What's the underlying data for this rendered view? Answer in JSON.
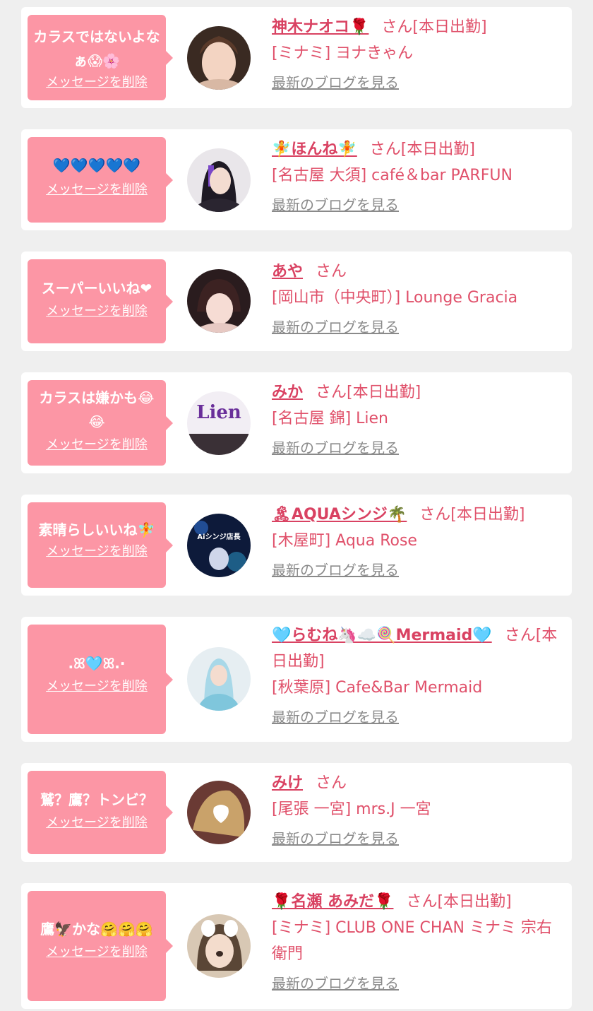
{
  "delete_label": "メッセージを削除",
  "blog_label": "最新のブログを見る",
  "colors": {
    "page_bg": "#efefef",
    "card_bg": "#ffffff",
    "bubble_bg": "#fc96a5",
    "name": "#d94262",
    "text_pink": "#e0506a",
    "blog_link": "#8a8a8a"
  },
  "messages": [
    {
      "text": "カラスではないよなぁ😱🌸",
      "delete_label": "メッセージを削除",
      "avatar": "avatar-photo",
      "name": "神木ナオコ🌹",
      "suffix": "さん[本日出勤]",
      "shop": "[ミナミ] ヨナきゃん",
      "blog_label": "最新のブログを見る"
    },
    {
      "text": "💙💙💙💙💙",
      "delete_label": "メッセージを削除",
      "avatar": "avatar-photo",
      "name": "🧚ほんね🧚",
      "suffix": "さん[本日出勤]",
      "shop": "[名古屋 大須] café＆bar PARFUN",
      "blog_label": "最新のブログを見る"
    },
    {
      "text": "スーパーいいね❤",
      "delete_label": "メッセージを削除",
      "avatar": "avatar-photo",
      "name": "あや",
      "suffix": "さん",
      "shop": "[岡山市（中央町）] Lounge Gracia",
      "blog_label": "最新のブログを見る"
    },
    {
      "text": "カラスは嫌かも😂😂",
      "delete_label": "メッセージを削除",
      "avatar": "avatar-photo",
      "avatar_text": "Lien",
      "name": "みか",
      "suffix": "さん[本日出勤]",
      "shop": "[名古屋 錦] Lien",
      "blog_label": "最新のブログを見る"
    },
    {
      "text": "素晴らしいいね🧚",
      "delete_label": "メッセージを削除",
      "avatar": "avatar-photo",
      "avatar_text": "Aiシンジ店長",
      "name": "🏝AQUAシンジ🌴",
      "suffix": "さん[本日出勤]",
      "shop": "[木屋町] Aqua Rose",
      "blog_label": "最新のブログを見る"
    },
    {
      "text": ".ꕤ🩵ꕤ.·",
      "delete_label": "メッセージを削除",
      "avatar": "avatar-photo",
      "name": "🩵らむね🦄☁️🍭Mermaid🩵",
      "suffix": "さん[本日出勤]",
      "shop": "[秋葉原] Cafe&Bar Mermaid",
      "blog_label": "最新のブログを見る"
    },
    {
      "text": "鷲？鷹？トンビ？",
      "delete_label": "メッセージを削除",
      "avatar": "avatar-photo",
      "name": "みけ",
      "suffix": "さん",
      "shop": "[尾張 一宮] mrs.J 一宮",
      "blog_label": "最新のブログを見る"
    },
    {
      "text": "鷹🦅かな🤗🤗🤗",
      "delete_label": "メッセージを削除",
      "avatar": "avatar-photo",
      "name": "🌹名瀬 あみだ🌹",
      "suffix": "さん[本日出勤]",
      "shop": "[ミナミ] CLUB ONE CHAN ミナミ 宗右衛門",
      "blog_label": "最新のブログを見る"
    }
  ]
}
